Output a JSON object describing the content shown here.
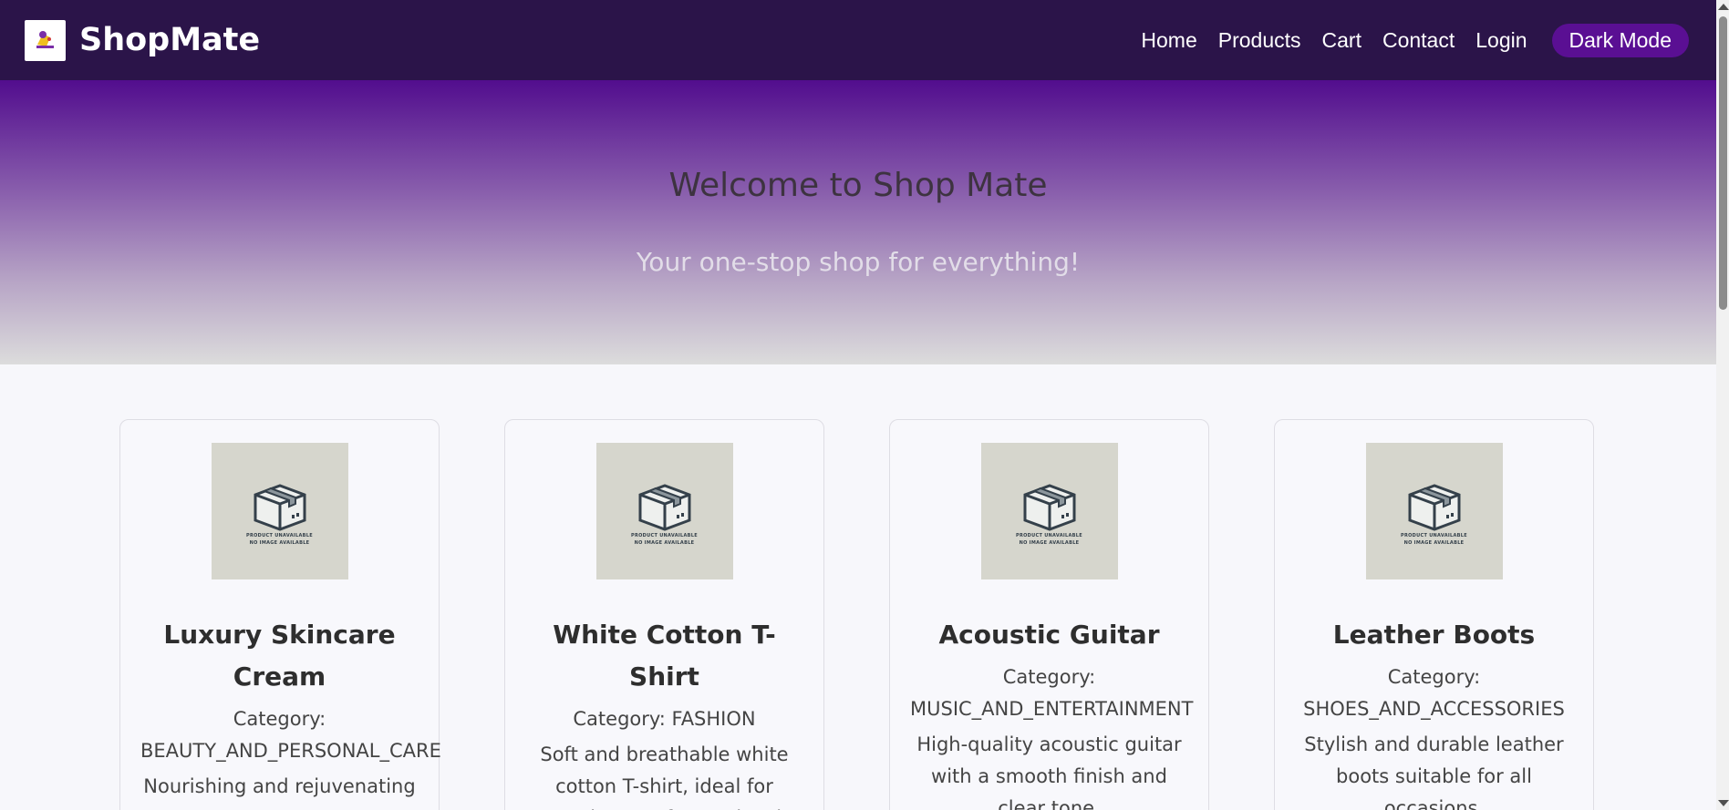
{
  "nav": {
    "brand": "ShopMate",
    "links": [
      "Home",
      "Products",
      "Cart",
      "Contact",
      "Login"
    ],
    "dark_mode_label": "Dark Mode"
  },
  "hero": {
    "title": "Welcome to Shop Mate",
    "subtitle": "Your one-stop shop for everything!"
  },
  "placeholder_image_text": [
    "PRODUCT UNAVAILABLE",
    "NO IMAGE AVAILABLE"
  ],
  "products": [
    {
      "name": "Luxury Skincare Cream",
      "category": "Category: BEAUTY_AND_PERSONAL_CARE",
      "description": "Nourishing and rejuvenating"
    },
    {
      "name": "White Cotton T-Shirt",
      "category": "Category: FASHION",
      "description": "Soft and breathable white cotton T-shirt, ideal for everyday comfort and style."
    },
    {
      "name": "Acoustic Guitar",
      "category": "Category: MUSIC_AND_ENTERTAINMENT",
      "description": "High-quality acoustic guitar with a smooth finish and clear tone."
    },
    {
      "name": "Leather Boots",
      "category": "Category: SHOES_AND_ACCESSORIES",
      "description": "Stylish and durable leather boots suitable for all occasions."
    }
  ],
  "colors": {
    "navbar": "#2b1449",
    "accent": "#5a0f93",
    "hero_top": "#520d8e"
  }
}
